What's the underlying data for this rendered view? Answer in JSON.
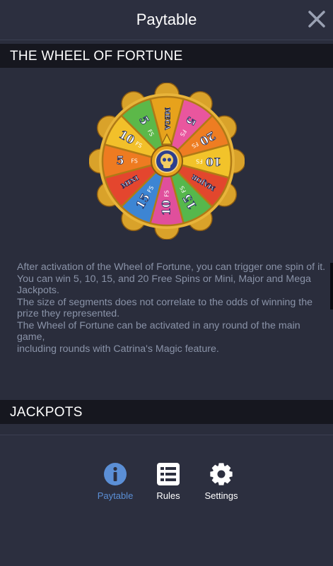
{
  "header": {
    "title": "Paytable"
  },
  "wheel_section": {
    "title": "THE WHEEL OF FORTUNE"
  },
  "wheel": {
    "hub_icon": "skull-icon",
    "segments": [
      {
        "label": "MEGA",
        "color": "#e7a21c"
      },
      {
        "label": "5",
        "sub": "FS",
        "color": "#e9569e"
      },
      {
        "label": "20",
        "sub": "FS",
        "color": "#ee7d22"
      },
      {
        "label": "10",
        "sub": "FS",
        "color": "#f2c32a"
      },
      {
        "label": "MAJOR",
        "color": "#e2472d"
      },
      {
        "label": "15",
        "sub": "FS",
        "color": "#56b74c"
      },
      {
        "label": "10",
        "sub": "FS",
        "color": "#e04f9c"
      },
      {
        "label": "15",
        "sub": "FS",
        "color": "#3d85d3"
      },
      {
        "label": "MINI",
        "color": "#e4462e"
      },
      {
        "label": "5",
        "sub": "FS",
        "color": "#ee7b21"
      },
      {
        "label": "10",
        "sub": "FS",
        "color": "#f2c02a"
      },
      {
        "label": "5",
        "sub": "FS",
        "color": "#5cb849"
      }
    ]
  },
  "description": {
    "lines": [
      "After activation of the Wheel of Fortune, you can trigger one spin of it.",
      "You can win 5, 10, 15, and 20 Free Spins or Mini, Major and Mega Jackpots.",
      "The size of segments does not correlate to the odds of winning the prize they represented.",
      "The Wheel of Fortune can be activated in any round of the main game,",
      "including rounds with Catrina's Magic feature."
    ]
  },
  "jackpots_section": {
    "title": "JACKPOTS"
  },
  "nav": {
    "items": [
      {
        "label": "Paytable",
        "icon": "info-icon",
        "active": true,
        "color": "#5b8fd6"
      },
      {
        "label": "Rules",
        "icon": "list-icon",
        "active": false
      },
      {
        "label": "Settings",
        "icon": "gear-icon",
        "active": false
      }
    ]
  }
}
